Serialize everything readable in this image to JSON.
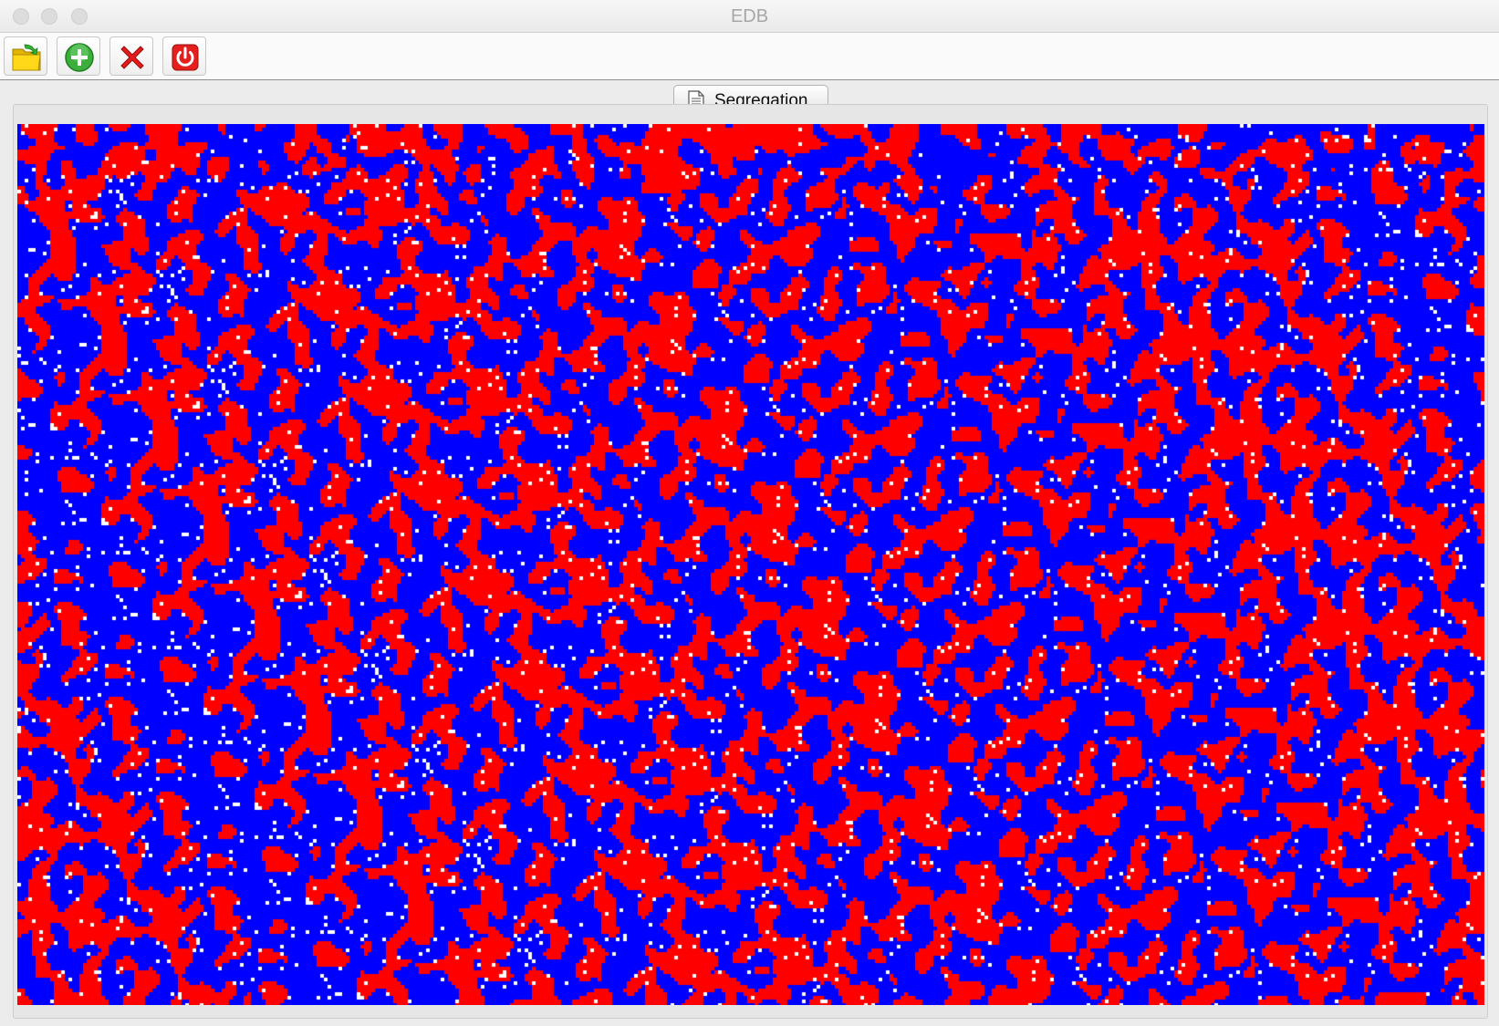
{
  "window": {
    "title": "EDB"
  },
  "toolbar": {
    "buttons": [
      {
        "icon": "open-folder-icon"
      },
      {
        "icon": "add-icon"
      },
      {
        "icon": "delete-icon"
      },
      {
        "icon": "power-icon"
      }
    ]
  },
  "tabs": [
    {
      "label": "Segregation",
      "icon": "document-icon"
    }
  ],
  "simulation": {
    "colors": {
      "group_a": "#ff0000",
      "group_b": "#0000ff",
      "empty": "#ffffff"
    }
  }
}
